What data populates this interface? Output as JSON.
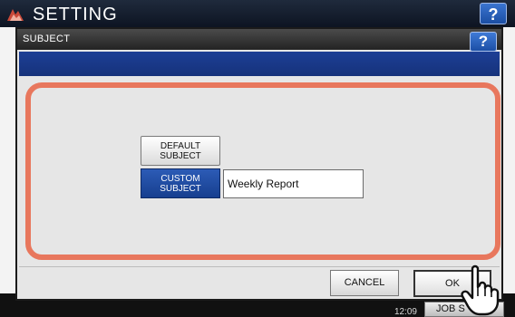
{
  "background": {
    "title": "SETTING",
    "help_label": "?",
    "clock_time": "12:09",
    "job_status_label": "JOB S"
  },
  "dialog": {
    "title": "SUBJECT",
    "help_label": "?",
    "default_subject_label_line1": "DEFAULT",
    "default_subject_label_line2": "SUBJECT",
    "custom_subject_label_line1": "CUSTOM",
    "custom_subject_label_line2": "SUBJECT",
    "subject_value": "Weekly Report",
    "cancel_label": "CANCEL",
    "ok_label": "OK"
  },
  "colors": {
    "highlight": "#e8775d",
    "accent_blue": "#1d3f96",
    "selected_button": "#2c5bb6"
  },
  "icons": {
    "app_logo": "setting-logo-icon",
    "pointer": "pointing-hand-icon"
  }
}
